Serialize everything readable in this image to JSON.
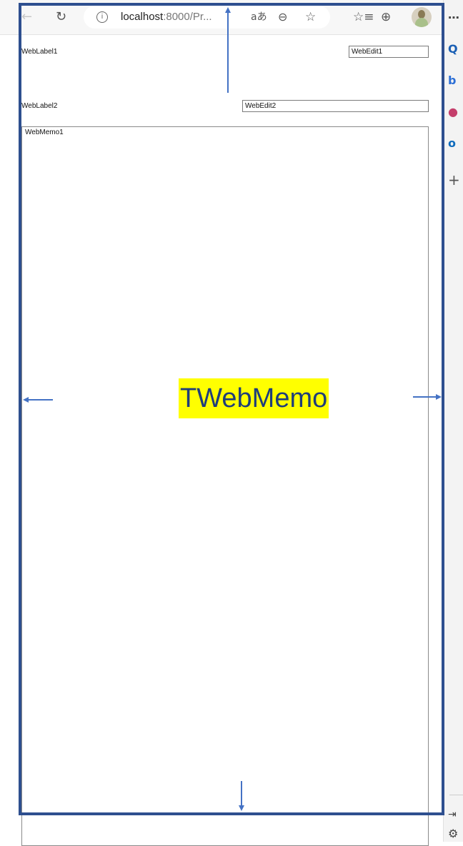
{
  "browser": {
    "back_icon": "arrow-left-icon",
    "reload_icon": "reload-icon",
    "info_icon": "info-icon",
    "url_host": "localhost",
    "url_rest": ":8000/Pr...",
    "read_aloud_icon": "read-aloud-icon",
    "translate_icon": "translate-icon",
    "zoom_icon": "zoom-out-icon",
    "favorite_add_icon": "add-favorite-icon",
    "favorites_icon": "favorites-icon",
    "collections_icon": "collections-icon",
    "more_icon": "more-icon"
  },
  "sidebar": {
    "items": [
      {
        "name": "search-icon",
        "color": "#1a5fb4"
      },
      {
        "name": "bing-chat-icon",
        "color": "#2c6fd6"
      },
      {
        "name": "office-icon",
        "color": "#c43e6b"
      },
      {
        "name": "outlook-icon",
        "color": "#0f6cbd"
      },
      {
        "name": "add-icon",
        "color": "#555555"
      }
    ],
    "bottom": [
      "hide-sidebar-icon",
      "settings-icon"
    ]
  },
  "form": {
    "label1": "WebLabel1",
    "edit1": "WebEdit1",
    "label2": "WebLabel2",
    "edit2": "WebEdit2",
    "memo": "WebMemo1"
  },
  "annotation": {
    "title": "TWebMemo",
    "highlight_color": "#ffff00",
    "frame_color": "#2e4f8f",
    "arrow_color": "#4472c4"
  }
}
